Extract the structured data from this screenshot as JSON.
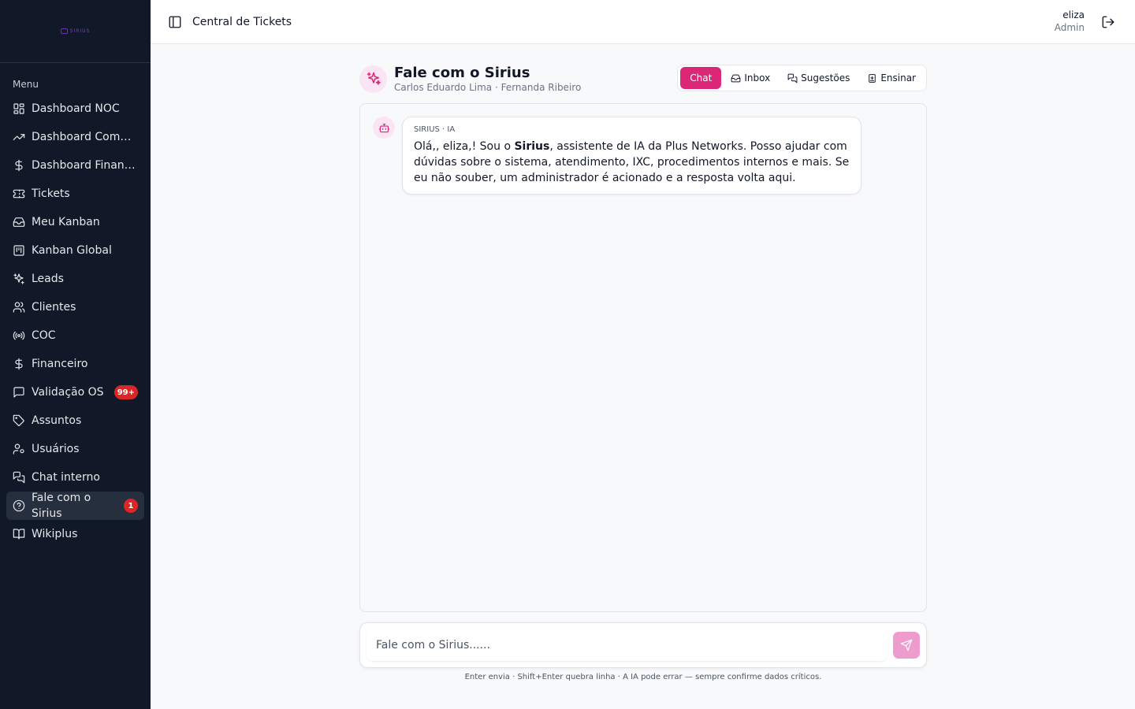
{
  "sidebar": {
    "logo_text": "SIRIUS",
    "menu_title": "Menu",
    "items": [
      {
        "label": "Dashboard NOC",
        "icon": "dashboard-grid-icon"
      },
      {
        "label": "Dashboard Comercial",
        "icon": "trending-up-icon"
      },
      {
        "label": "Dashboard Financeiro",
        "icon": "dollar-icon"
      },
      {
        "label": "Tickets",
        "icon": "ticket-icon"
      },
      {
        "label": "Meu Kanban",
        "icon": "inbox-icon"
      },
      {
        "label": "Kanban Global",
        "icon": "kanban-icon"
      },
      {
        "label": "Leads",
        "icon": "sparkles-icon"
      },
      {
        "label": "Clientes",
        "icon": "users-icon"
      },
      {
        "label": "COC",
        "icon": "radio-icon"
      },
      {
        "label": "Financeiro",
        "icon": "dollar-icon"
      },
      {
        "label": "Validação OS",
        "icon": "message-square-icon",
        "badge": "99+"
      },
      {
        "label": "Assuntos",
        "icon": "tag-icon"
      },
      {
        "label": "Usuários",
        "icon": "user-cog-icon"
      },
      {
        "label": "Chat interno",
        "icon": "messages-icon"
      },
      {
        "label": "Fale com o Sirius",
        "icon": "help-circle-icon",
        "badge": "1",
        "active": true
      },
      {
        "label": "Wikiplus",
        "icon": "book-open-icon"
      }
    ]
  },
  "header": {
    "title": "Central de Tickets",
    "user_name": "eliza",
    "user_role": "Admin"
  },
  "page": {
    "title": "Fale com o Sirius",
    "subtitle": "Carlos Eduardo Lima · Fernanda Ribeiro",
    "tabs": [
      {
        "label": "Chat",
        "active": true
      },
      {
        "label": "Inbox",
        "icon": "inbox-icon"
      },
      {
        "label": "Sugestões",
        "icon": "messages-icon"
      },
      {
        "label": "Ensinar",
        "icon": "book-plus-icon"
      }
    ]
  },
  "chat": {
    "messages": [
      {
        "sender": "SIRIUS · IA",
        "text_before": "Olá,, eliza,! Sou o ",
        "text_bold": "Sirius",
        "text_after": ", assistente de IA da Plus Networks. Posso ajudar com dúvidas sobre o sistema, atendimento, IXC, procedimentos internos e mais. Se eu não souber, um administrador é acionado e a resposta volta aqui."
      }
    ]
  },
  "composer": {
    "placeholder": "Fale com o Sirius......",
    "value": "",
    "hint": "Enter envia · Shift+Enter quebra linha · A IA pode errar — sempre confirme dados críticos."
  },
  "colors": {
    "accent": "#db2777",
    "sidebar_bg": "#111827",
    "badge": "#dc2626",
    "send_button": "#ee9bcd"
  }
}
